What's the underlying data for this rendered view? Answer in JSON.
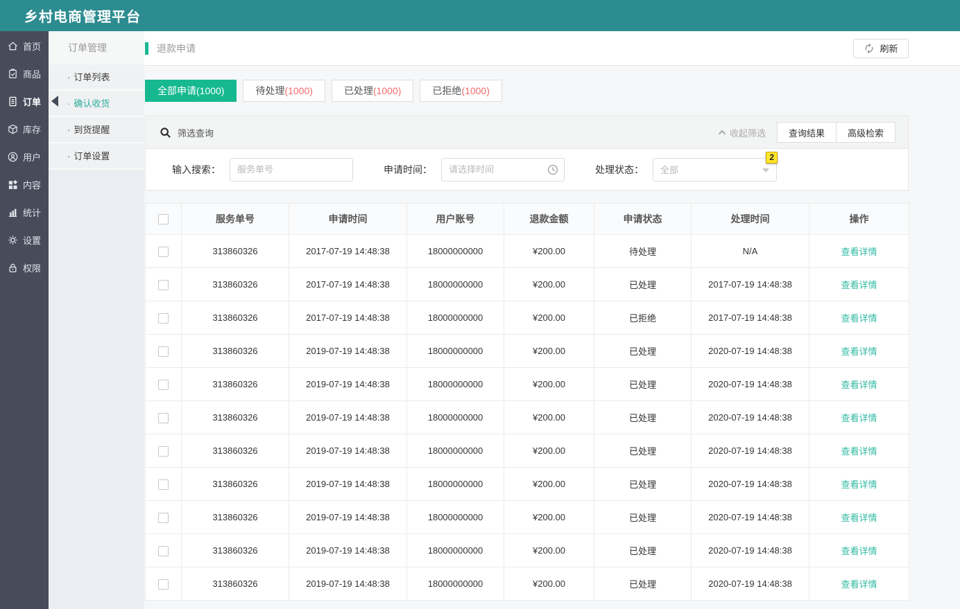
{
  "app": {
    "title": "乡村电商管理平台"
  },
  "colors": {
    "topbar_teal": "#2d8c90",
    "sidebar_dark": "#474c5b",
    "accent_green": "#16b98f",
    "link_teal": "#30b9a3",
    "count_red": "#f06a6a",
    "hint_badge_yellow": "#ffe62b"
  },
  "sidebar": {
    "items": [
      {
        "label": "首页",
        "icon": "home-icon",
        "active": false
      },
      {
        "label": "商品",
        "icon": "goods-icon",
        "active": false
      },
      {
        "label": "订单",
        "icon": "order-icon",
        "active": true
      },
      {
        "label": "库存",
        "icon": "stock-icon",
        "active": false
      },
      {
        "label": "用户",
        "icon": "user-icon",
        "active": false
      },
      {
        "label": "内容",
        "icon": "content-icon",
        "active": false
      },
      {
        "label": "统计",
        "icon": "stats-icon",
        "active": false
      },
      {
        "label": "设置",
        "icon": "settings-icon",
        "active": false
      },
      {
        "label": "权限",
        "icon": "permission-icon",
        "active": false
      }
    ]
  },
  "submenu": {
    "title": "订单管理",
    "items": [
      {
        "label": "订单列表",
        "active": false
      },
      {
        "label": "确认收货",
        "active": true
      },
      {
        "label": "到货提醒",
        "active": false
      },
      {
        "label": "订单设置",
        "active": false
      }
    ]
  },
  "page": {
    "breadcrumb": "退款申请",
    "refresh_label": "刷新"
  },
  "tabs": [
    {
      "label": "全部申请",
      "count": "(1000)",
      "active": true
    },
    {
      "label": "待处理",
      "count": "(1000)",
      "active": false
    },
    {
      "label": "已处理",
      "count": "(1000)",
      "active": false
    },
    {
      "label": "已拒绝",
      "count": "(1000)",
      "active": false
    }
  ],
  "filter": {
    "title": "筛选查询",
    "collapse_label": "收起筛选",
    "result_button": "查询结果",
    "advanced_button": "高级检索",
    "fields": [
      {
        "label": "输入搜索：",
        "placeholder": "服务单号"
      },
      {
        "label": "申请时间：",
        "placeholder": "请选择时间"
      },
      {
        "label": "处理状态：",
        "value": "全部",
        "badge": "2"
      }
    ]
  },
  "table": {
    "columns": [
      "服务单号",
      "申请时间",
      "用户账号",
      "退款金额",
      "申请状态",
      "处理时间",
      "操作"
    ],
    "action_label": "查看详情",
    "rows": [
      {
        "no": "313860326",
        "apply_time": "2017-07-19 14:48:38",
        "account": "18000000000",
        "amount": "¥200.00",
        "status": "待处理",
        "process_time": "N/A"
      },
      {
        "no": "313860326",
        "apply_time": "2017-07-19 14:48:38",
        "account": "18000000000",
        "amount": "¥200.00",
        "status": "已处理",
        "process_time": "2017-07-19 14:48:38"
      },
      {
        "no": "313860326",
        "apply_time": "2017-07-19 14:48:38",
        "account": "18000000000",
        "amount": "¥200.00",
        "status": "已拒绝",
        "process_time": "2017-07-19 14:48:38"
      },
      {
        "no": "313860326",
        "apply_time": "2019-07-19 14:48:38",
        "account": "18000000000",
        "amount": "¥200.00",
        "status": "已处理",
        "process_time": "2020-07-19 14:48:38"
      },
      {
        "no": "313860326",
        "apply_time": "2019-07-19 14:48:38",
        "account": "18000000000",
        "amount": "¥200.00",
        "status": "已处理",
        "process_time": "2020-07-19 14:48:38"
      },
      {
        "no": "313860326",
        "apply_time": "2019-07-19 14:48:38",
        "account": "18000000000",
        "amount": "¥200.00",
        "status": "已处理",
        "process_time": "2020-07-19 14:48:38"
      },
      {
        "no": "313860326",
        "apply_time": "2019-07-19 14:48:38",
        "account": "18000000000",
        "amount": "¥200.00",
        "status": "已处理",
        "process_time": "2020-07-19 14:48:38"
      },
      {
        "no": "313860326",
        "apply_time": "2019-07-19 14:48:38",
        "account": "18000000000",
        "amount": "¥200.00",
        "status": "已处理",
        "process_time": "2020-07-19 14:48:38"
      },
      {
        "no": "313860326",
        "apply_time": "2019-07-19 14:48:38",
        "account": "18000000000",
        "amount": "¥200.00",
        "status": "已处理",
        "process_time": "2020-07-19 14:48:38"
      },
      {
        "no": "313860326",
        "apply_time": "2019-07-19 14:48:38",
        "account": "18000000000",
        "amount": "¥200.00",
        "status": "已处理",
        "process_time": "2020-07-19 14:48:38"
      },
      {
        "no": "313860326",
        "apply_time": "2019-07-19 14:48:38",
        "account": "18000000000",
        "amount": "¥200.00",
        "status": "已处理",
        "process_time": "2020-07-19 14:48:38"
      }
    ]
  }
}
